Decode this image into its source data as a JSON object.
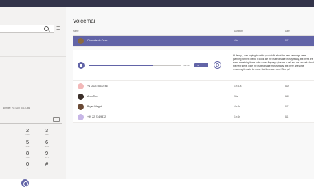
{
  "app": {
    "colors": {
      "accent": "#6264a7",
      "topbar": "#33344a"
    }
  },
  "sidebar": {
    "search_placeholder": "",
    "dial_field_label": "Number: +1 (425) 872-7766",
    "dialpad": [
      {
        "num": "2",
        "sub": "ABC"
      },
      {
        "num": "3",
        "sub": "DEF"
      },
      {
        "num": "5",
        "sub": "JKL"
      },
      {
        "num": "6",
        "sub": "MNO"
      },
      {
        "num": "8",
        "sub": "TUV"
      },
      {
        "num": "9",
        "sub": "WXY"
      },
      {
        "num": "0",
        "sub": "+"
      },
      {
        "num": "#",
        "sub": ""
      }
    ],
    "icons": [
      "search-icon",
      "filter-icon",
      "backspace-icon",
      "phone-icon"
    ]
  },
  "main": {
    "title": "Voicemail",
    "columns": {
      "name": "Name",
      "duration": "Duration",
      "date": "Date"
    },
    "rows": [
      {
        "name": "Charlotte de Crum",
        "duration": "45s",
        "date": "8/17"
      },
      {
        "name": "+1 (202) 555-0786",
        "duration": "1m 47s",
        "date": "8/20"
      },
      {
        "name": "Alvin Tao",
        "duration": "38s",
        "date": "8/15"
      },
      {
        "name": "Bryan Wright",
        "duration": "4m 5s",
        "date": "8/17"
      },
      {
        "name": "+99 22 234 9872",
        "duration": "1m 6s",
        "date": "8/1"
      }
    ],
    "player": {
      "time": "-00:43",
      "speed": "1x",
      "progress": 0.7
    },
    "transcript": "Hi Jenny, I was hoping to catch you to talk about the new campaign we're planning for next week. It looks like the materials are mostly ready, but there are some remaining items to be done. Anyways give me a call and we can talk about the next steps. I like the materials are mostly ready, but there are some remaining items to be done. But there are some! See ya!"
  }
}
